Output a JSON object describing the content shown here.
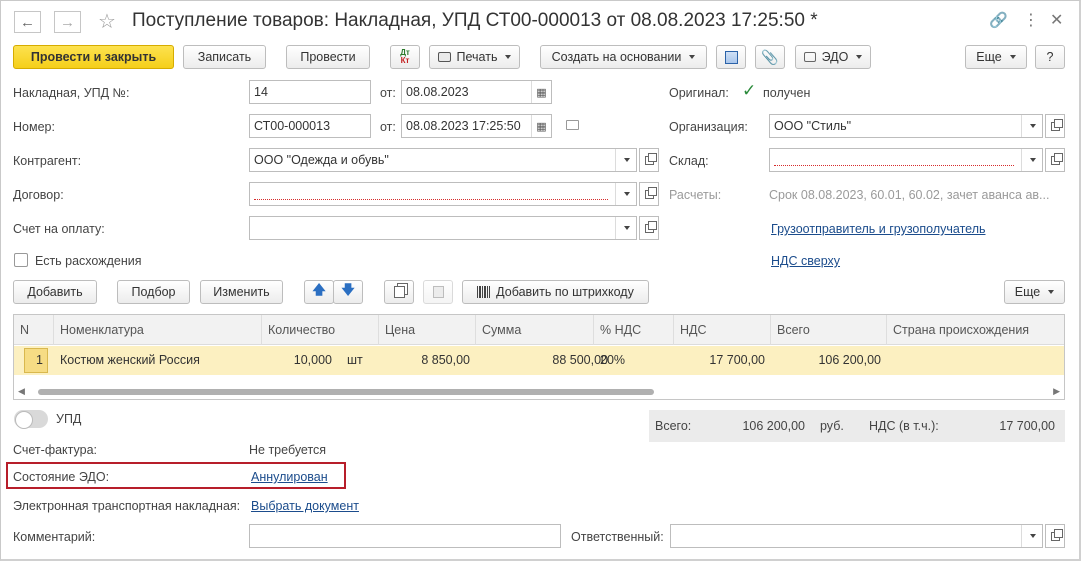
{
  "window": {
    "title": "Поступление товаров: Накладная, УПД СТ00-000013 от 08.08.2023 17:25:50 *"
  },
  "toolbar": {
    "post_close": "Провести и закрыть",
    "save": "Записать",
    "post": "Провести",
    "dtkt": "Дт",
    "dtkt2": "Кт",
    "print": "Печать",
    "create_based": "Создать на основании",
    "edo": "ЭДО",
    "more": "Еще",
    "help": "?"
  },
  "form": {
    "invoice_label": "Накладная, УПД №:",
    "invoice_no": "14",
    "from_label": "от:",
    "invoice_date": "08.08.2023",
    "number_label": "Номер:",
    "number": "СТ00-000013",
    "number_date": "08.08.2023 17:25:50",
    "contractor_label": "Контрагент:",
    "contractor": "ООО \"Одежда и обувь\"",
    "contract_label": "Договор:",
    "contract": "",
    "payment_label": "Счет на оплату:",
    "payment": "",
    "discrepancy_label": "Есть расхождения",
    "original_label": "Оригинал:",
    "original_value": "получен",
    "org_label": "Организация:",
    "org": "ООО \"Стиль\"",
    "warehouse_label": "Склад:",
    "warehouse": "",
    "settlements_label": "Расчеты:",
    "settlements": "Срок 08.08.2023, 60.01, 60.02, зачет аванса ав...",
    "shipper_link": "Грузоотправитель и грузополучатель",
    "vat_link": "НДС сверху"
  },
  "table_toolbar": {
    "add": "Добавить",
    "select": "Подбор",
    "edit": "Изменить",
    "barcode": "Добавить по штрихкоду",
    "more": "Еще"
  },
  "table": {
    "headers": [
      "N",
      "Номенклатура",
      "Количество",
      "Цена",
      "Сумма",
      "% НДС",
      "НДС",
      "Всего",
      "Страна происхождения"
    ],
    "rows": [
      {
        "n": "1",
        "item": "Костюм женский Россия",
        "qty": "10,000",
        "unit": "шт",
        "price": "8 850,00",
        "sum": "88 500,00",
        "vat_rate": "20%",
        "vat": "17 700,00",
        "total": "106 200,00",
        "country": ""
      }
    ]
  },
  "footer": {
    "upd_label": "УПД",
    "invoice_fact_label": "Счет-фактура:",
    "invoice_fact_value": "Не требуется",
    "edo_state_label": "Состояние ЭДО:",
    "edo_state_value": "Аннулирован",
    "etn_label": "Электронная транспортная накладная:",
    "etn_link": "Выбрать документ",
    "comment_label": "Комментарий:",
    "comment": "",
    "responsible_label": "Ответственный:",
    "responsible": "",
    "total_label": "Всего:",
    "total_value": "106 200,00",
    "currency": "руб.",
    "vat_incl_label": "НДС (в т.ч.):",
    "vat_incl_value": "17 700,00"
  }
}
